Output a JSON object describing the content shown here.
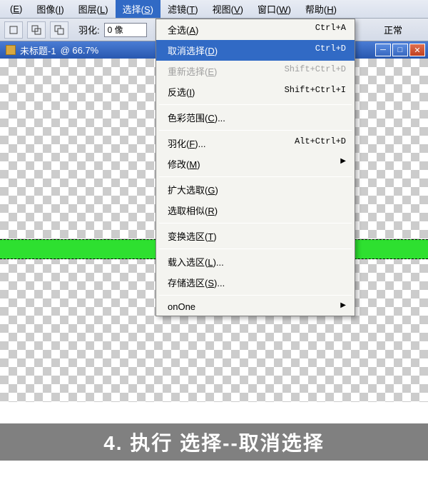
{
  "menubar": {
    "items": [
      {
        "label": "(E)",
        "mnemonic": "E"
      },
      {
        "label": "图像(I)",
        "mnemonic": "I"
      },
      {
        "label": "图层(L)",
        "mnemonic": "L"
      },
      {
        "label": "选择(S)",
        "mnemonic": "S",
        "active": true
      },
      {
        "label": "滤镜(T)",
        "mnemonic": "T"
      },
      {
        "label": "视图(V)",
        "mnemonic": "V"
      },
      {
        "label": "窗口(W)",
        "mnemonic": "W"
      },
      {
        "label": "帮助(H)",
        "mnemonic": "H"
      }
    ]
  },
  "toolbar": {
    "feather_label": "羽化:",
    "feather_value": "0 像",
    "mode_text": "正常"
  },
  "document": {
    "title": "未标题-1",
    "zoom": "@ 66.7%"
  },
  "dropdown": {
    "items": [
      {
        "label": "全选(A)",
        "shortcut": "Ctrl+A"
      },
      {
        "label": "取消选择(D)",
        "shortcut": "Ctrl+D",
        "highlighted": true
      },
      {
        "label": "重新选择(E)",
        "shortcut": "Shift+Ctrl+D",
        "disabled": true
      },
      {
        "label": "反选(I)",
        "shortcut": "Shift+Ctrl+I"
      },
      {
        "sep": true
      },
      {
        "label": "色彩范围(C)..."
      },
      {
        "sep": true
      },
      {
        "label": "羽化(F)...",
        "shortcut": "Alt+Ctrl+D"
      },
      {
        "label": "修改(M)",
        "submenu": true
      },
      {
        "sep": true
      },
      {
        "label": "扩大选取(G)"
      },
      {
        "label": "选取相似(R)"
      },
      {
        "sep": true
      },
      {
        "label": "变换选区(T)"
      },
      {
        "sep": true
      },
      {
        "label": "载入选区(L)..."
      },
      {
        "label": "存储选区(S)..."
      },
      {
        "sep": true
      },
      {
        "label": "onOne",
        "submenu": true
      }
    ]
  },
  "caption": "4. 执行 选择--取消选择",
  "icons": {
    "minimize": "─",
    "maximize": "□",
    "close": "✕"
  }
}
